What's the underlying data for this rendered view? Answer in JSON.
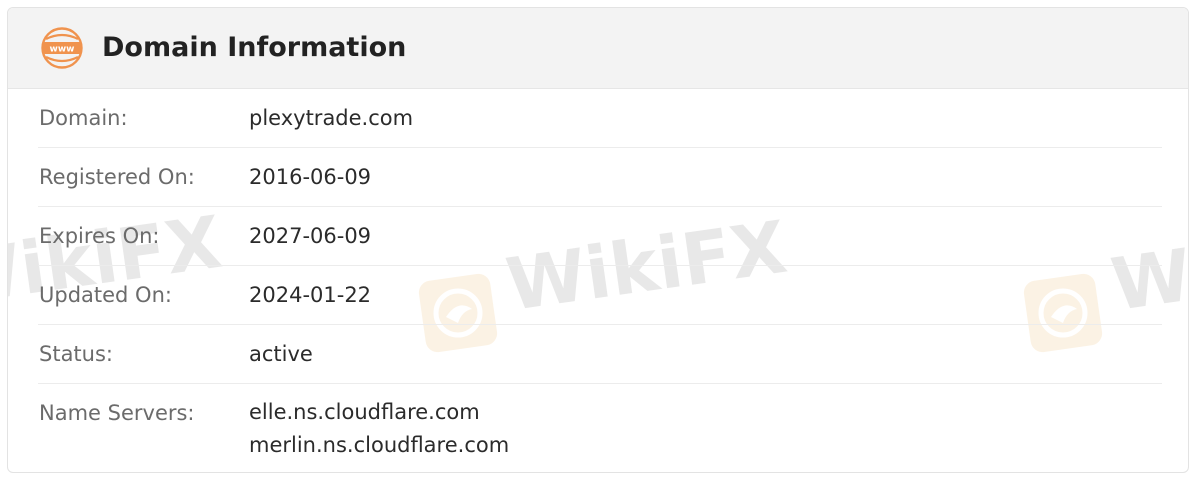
{
  "header": {
    "title": "Domain Information",
    "icon": "www-globe-icon",
    "icon_text": "www",
    "accent_color": "#f0934e"
  },
  "rows": [
    {
      "label": "Domain:",
      "value": "plexytrade.com"
    },
    {
      "label": "Registered On:",
      "value": "2016-06-09"
    },
    {
      "label": "Expires On:",
      "value": "2027-06-09"
    },
    {
      "label": "Updated On:",
      "value": "2024-01-22"
    },
    {
      "label": "Status:",
      "value": "active"
    }
  ],
  "name_servers": {
    "label": "Name Servers:",
    "values": [
      "elle.ns.cloudflare.com",
      "merlin.ns.cloudflare.com"
    ]
  },
  "watermark": {
    "text": "WikiFX",
    "icon": "wikifx-eagle-logo"
  }
}
